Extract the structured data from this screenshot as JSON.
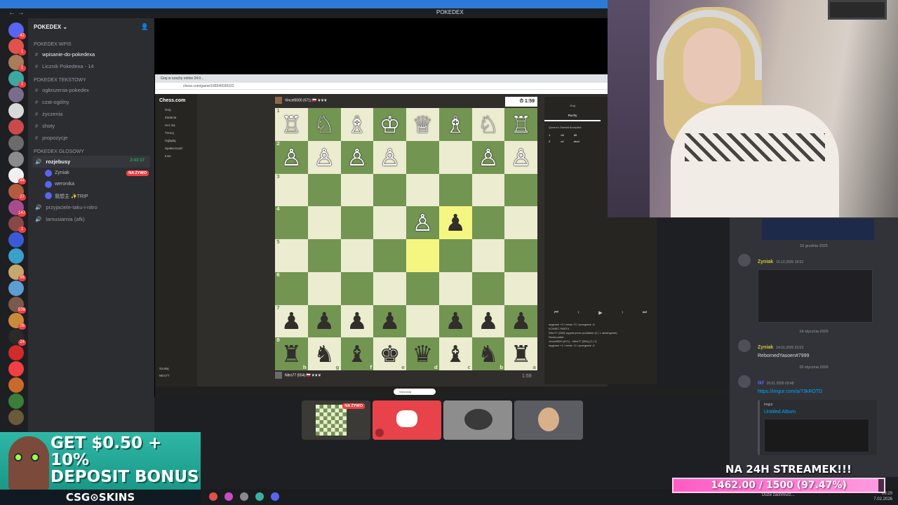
{
  "window": {
    "title": "POKEDEX"
  },
  "servers": [
    {
      "badge": "42",
      "color": "#5865f2"
    },
    {
      "badge": "1",
      "color": "#e0524b"
    },
    {
      "badge": "1",
      "color": "#a97c5a"
    },
    {
      "badge": "1",
      "color": "#3ba9a2"
    },
    {
      "badge": "",
      "color": "#7a6c8c"
    },
    {
      "badge": "",
      "color": "#d9d9d9"
    },
    {
      "badge": "",
      "color": "#c94a4a"
    },
    {
      "badge": "",
      "color": "#6b6b6b"
    },
    {
      "badge": "",
      "color": "#8b8b8b"
    },
    {
      "badge": "44",
      "color": "#f0f0f0"
    },
    {
      "badge": "27",
      "color": "#b45b3e"
    },
    {
      "badge": "147",
      "color": "#a84b8c"
    },
    {
      "badge": "1",
      "color": "#884848"
    },
    {
      "badge": "",
      "color": "#3b5bd6"
    },
    {
      "badge": "",
      "color": "#3aa0c9"
    },
    {
      "badge": "96",
      "color": "#c7a86c"
    },
    {
      "badge": "",
      "color": "#5c9ed1"
    },
    {
      "badge": "539",
      "color": "#7a5a4a"
    },
    {
      "badge": "26",
      "color": "#c98a3a"
    },
    {
      "badge": "24",
      "color": "#2a2a2a"
    },
    {
      "badge": "",
      "color": "#d12b2b"
    },
    {
      "badge": "",
      "color": "#f23f43"
    },
    {
      "badge": "",
      "color": "#c76a2a"
    },
    {
      "badge": "",
      "color": "#3b7d3b"
    },
    {
      "badge": "",
      "color": "#6a5a3a"
    }
  ],
  "sidebar": {
    "guild_name": "POKEDEX",
    "categories": [
      {
        "name": "POKEDEX Wpis",
        "channels": [
          {
            "name": "wpisanie-do-pokedexa",
            "active": true
          },
          {
            "name": "Licznik Pokedexa - 14",
            "active": false
          }
        ]
      },
      {
        "name": "POKEDEX Tekstowy",
        "channels": [
          {
            "name": "ogłoszenia-pokedex",
            "active": false
          },
          {
            "name": "czat-ogólny",
            "active": false
          },
          {
            "name": "życzenia",
            "active": false
          },
          {
            "name": "shoty",
            "active": false
          },
          {
            "name": "propozycje",
            "active": false
          }
        ]
      }
    ],
    "voice_category": "POKEDEX GŁOSOWY",
    "voice_channel": {
      "name": "rozjebusy",
      "timer": "2:43:17"
    },
    "members": [
      {
        "name": "Zyniak",
        "live": "NA ŻYWO"
      },
      {
        "name": "weronika",
        "live": ""
      },
      {
        "name": "我想主 ✨TRIP",
        "live": ""
      }
    ],
    "other_voice": [
      "przyjaciele-taku-i-nitro",
      "lamusiarnia (afk)"
    ]
  },
  "browser": {
    "tab": "Graj w szachy online 24:0...",
    "url": "chess.com/game/166546039222"
  },
  "chess": {
    "logo": "Chess.com",
    "nav": [
      "Graj",
      "Zadania",
      "Ucz się",
      "Trenuj",
      "Oglądaj",
      "Społeczność",
      "Inne"
    ],
    "nav_bottom": [
      "Szukaj",
      "Nitro77"
    ],
    "top_player": "Vincel5000 (671) 🇵🇱 ♛♛♛",
    "top_clock": "1:59",
    "bottom_player": "Nitro77 (554) 🇵🇱 ♛♛♛",
    "bottom_clock": "1:59",
    "ranks": [
      "1",
      "2",
      "3",
      "4",
      "5",
      "6",
      "7",
      "8"
    ],
    "files": [
      "h",
      "g",
      "f",
      "e",
      "d",
      "c",
      "b",
      "a"
    ],
    "board": [
      [
        "♖",
        "♘",
        "♗",
        "♔",
        "♕",
        "♗",
        "♘",
        "♖"
      ],
      [
        "♙",
        "♙",
        "♙",
        "♙",
        "",
        "",
        "♙",
        "♙"
      ],
      [
        "",
        "",
        "",
        "",
        "",
        "",
        "",
        ""
      ],
      [
        "",
        "",
        "",
        "",
        "♙",
        "♟",
        "",
        ""
      ],
      [
        "",
        "",
        "",
        "",
        "",
        "",
        "",
        ""
      ],
      [
        "",
        "",
        "",
        "",
        "",
        "",
        "",
        ""
      ],
      [
        "♟",
        "♟",
        "♟",
        "♟",
        "",
        "♟",
        "♟",
        "♟"
      ],
      [
        "♜",
        "♞",
        "♝",
        "♚",
        "♛",
        "♝",
        "♞",
        "♜"
      ]
    ],
    "moves_tabs": [
      "Graj",
      "Nowa partia"
    ],
    "moves_header": "Ruchy",
    "opening": "Queen's Gambit Accepted",
    "moves": [
      {
        "n": "1.",
        "w": "d4",
        "b": "d5"
      },
      {
        "n": "2.",
        "w": "c4",
        "b": "dxc4"
      }
    ],
    "log": [
      "wygrane +0 / remis +0 / przegrane -6",
      "KONIEC PARTII",
      "Nitro77 (554) wygrał przez poddanie (2 | 1 rankingowe)",
      "Nowa partia",
      "Vincel5000 (671) - Nitro77 (554) (2 | 1)",
      "wygrane +1 / remis +2 / przegrane -6"
    ],
    "ctrls": [
      "⏮",
      "‹",
      "▶",
      "›",
      "⏭"
    ]
  },
  "stream_tiles": [
    {
      "label": "NA ŻYWO"
    },
    {
      "label": ""
    },
    {
      "label": ""
    },
    {
      "label": ""
    }
  ],
  "chat": {
    "date1": "16 grudnia 2025",
    "msg1": {
      "author": "Zyniak",
      "ts": "16.12.2025 18:52"
    },
    "date2": "14 stycznia 2026",
    "msg2": {
      "author": "Zyniak",
      "ts": "14.01.2026 23:03",
      "text": "RebornedYasoen#7999"
    },
    "date3": "20 stycznia 2026",
    "msg3": {
      "author": "tkf",
      "ts": "20.01.2026 03:48",
      "link": "https://imgur.com/a/73kROTD",
      "provider": "Imgur",
      "embed_title": "Untitled Album"
    }
  },
  "ad": {
    "headline1": "GET $0.50 + 10%",
    "headline2": "DEPOSIT BONUS",
    "brand": "CSG⊙SKINS"
  },
  "goal": {
    "title": "NA 24H STREAMEK!!!",
    "text": "1462.00 / 1500 (97.47%)",
    "progress": 0.9747
  },
  "taskbar": {
    "tray": "Duże zachmurz...",
    "time": "19:29",
    "date": "7.02.2026"
  }
}
